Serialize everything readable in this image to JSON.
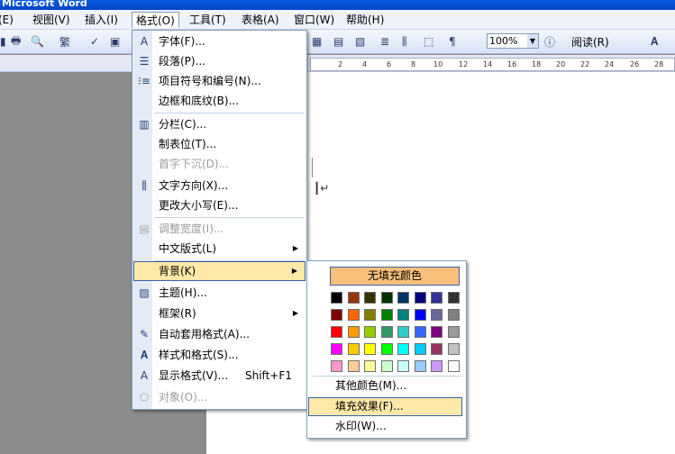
{
  "window": {
    "title": "Microsoft Word"
  },
  "menubar": [
    {
      "label": "格式(O)",
      "id": "format"
    }
  ],
  "menubar_items": [
    "(E)",
    "视图(V)",
    "插入(I)",
    "格式(O)",
    "工具(T)",
    "表格(A)",
    "窗口(W)",
    "帮助(H)"
  ],
  "toolbar": {
    "zoom": "100%",
    "read_label": "阅读(R)"
  },
  "ruler": {
    "ticks": [
      "2",
      "4",
      "6",
      "8",
      "10",
      "12",
      "14",
      "16",
      "18",
      "20",
      "22",
      "24",
      "26",
      "28"
    ]
  },
  "format_menu": {
    "items": [
      {
        "label": "字体(F)...",
        "icon": "font-A-icon",
        "disabled": false
      },
      {
        "label": "段落(P)...",
        "icon": "paragraph-icon",
        "disabled": false
      },
      {
        "label": "项目符号和编号(N)...",
        "icon": "bullets-icon",
        "disabled": false
      },
      {
        "label": "边框和底纹(B)...",
        "icon": "",
        "disabled": false
      },
      {
        "label": "分栏(C)...",
        "icon": "columns-icon",
        "disabled": false
      },
      {
        "label": "制表位(T)...",
        "icon": "",
        "disabled": false
      },
      {
        "label": "首字下沉(D)...",
        "icon": "",
        "disabled": true
      },
      {
        "label": "文字方向(X)...",
        "icon": "text-direction-icon",
        "disabled": false
      },
      {
        "label": "更改大小写(E)...",
        "icon": "",
        "disabled": false
      },
      {
        "label": "调整宽度(I)...",
        "icon": "fit-width-icon",
        "disabled": true
      },
      {
        "label": "中文版式(L)",
        "icon": "",
        "disabled": false,
        "submenu": true
      },
      {
        "label": "背景(K)",
        "icon": "",
        "disabled": false,
        "submenu": true,
        "highlighted": true
      },
      {
        "label": "主题(H)...",
        "icon": "theme-icon",
        "disabled": false
      },
      {
        "label": "框架(R)",
        "icon": "",
        "disabled": false,
        "submenu": true
      },
      {
        "label": "自动套用格式(A)...",
        "icon": "autoformat-icon",
        "disabled": false
      },
      {
        "label": "样式和格式(S)...",
        "icon": "styles-icon",
        "disabled": false
      },
      {
        "label": "显示格式(V)...",
        "icon": "reveal-format-icon",
        "disabled": false,
        "shortcut": "Shift+F1"
      },
      {
        "label": "对象(O)...",
        "icon": "object-icon",
        "disabled": true
      }
    ]
  },
  "background_submenu": {
    "no_fill": "无填充颜色",
    "more_colors": "其他颜色(M)...",
    "fill_effects": "填充效果(F)...",
    "watermark": "水印(W)...",
    "colors": [
      [
        "#000000",
        "#993300",
        "#333300",
        "#003300",
        "#003366",
        "#000080",
        "#333399",
        "#333333"
      ],
      [
        "#800000",
        "#ff6600",
        "#808000",
        "#008000",
        "#008080",
        "#0000ff",
        "#666699",
        "#808080"
      ],
      [
        "#ff0000",
        "#ff9900",
        "#99cc00",
        "#339966",
        "#33cccc",
        "#3366ff",
        "#800080",
        "#999999"
      ],
      [
        "#ff00ff",
        "#ffcc00",
        "#ffff00",
        "#00ff00",
        "#00ffff",
        "#00ccff",
        "#993366",
        "#c0c0c0"
      ],
      [
        "#ff99cc",
        "#ffcc99",
        "#ffff99",
        "#ccffcc",
        "#ccffff",
        "#99ccff",
        "#cc99ff",
        "#ffffff"
      ]
    ]
  }
}
